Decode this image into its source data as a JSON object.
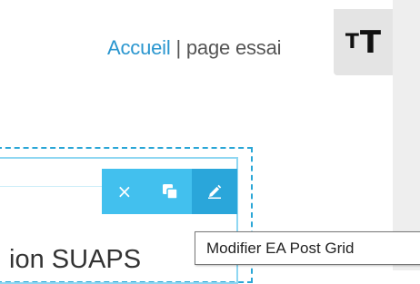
{
  "breadcrumb": {
    "home": "Accueil",
    "separator": "|",
    "current": "page essai"
  },
  "text_size_button": {
    "small": "T",
    "big": "T"
  },
  "toolbar": {
    "delete_icon": "×",
    "duplicate_icon": "duplicate-icon",
    "edit_icon": "edit-icon"
  },
  "heading": "ion SUAPS",
  "tooltip": "Modifier EA Post Grid",
  "colors": {
    "accent": "#42c0ee",
    "accent_dark": "#2aa6da",
    "link": "#2a96cf"
  }
}
